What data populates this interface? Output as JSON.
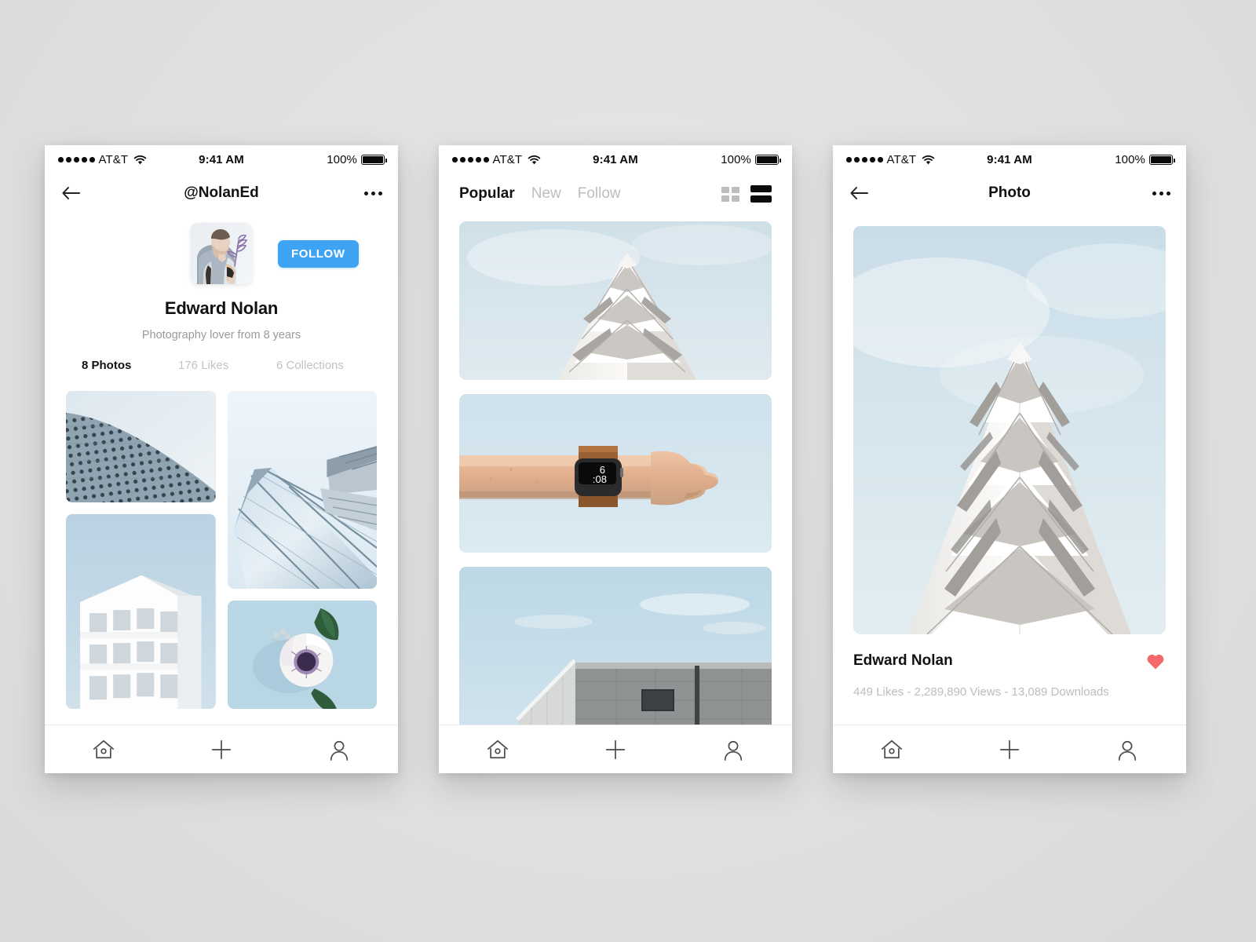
{
  "background_color": "#e0e0e0",
  "accent_color": "#3fa3f4",
  "heart_color": "#f4696a",
  "status_bar": {
    "carrier": "AT&T",
    "signal_dots": 5,
    "wifi_icon": "wifi-icon",
    "time": "9:41 AM",
    "battery_percent": "100%",
    "battery_icon": "battery-full-icon"
  },
  "screen_profile": {
    "nav": {
      "back_icon": "arrow-left-icon",
      "title": "@NolanEd",
      "more_icon": "ellipsis-icon"
    },
    "avatar_alt": "avatar",
    "follow_label": "FOLLOW",
    "name": "Edward Nolan",
    "bio": "Photography lover from 8 years",
    "stats": [
      {
        "label": "8 Photos",
        "active": true
      },
      {
        "label": "176 Likes",
        "active": false
      },
      {
        "label": "6 Collections",
        "active": false
      }
    ],
    "photos": [
      {
        "name": "perforated-facade-photo"
      },
      {
        "name": "glass-tower-photo"
      },
      {
        "name": "white-apartment-photo"
      },
      {
        "name": "anemone-flower-photo"
      }
    ]
  },
  "screen_feed": {
    "tabs": [
      {
        "label": "Popular",
        "active": true
      },
      {
        "label": "New",
        "active": false
      },
      {
        "label": "Follow",
        "active": false
      }
    ],
    "view_modes": [
      {
        "name": "grid-view-icon",
        "active": false
      },
      {
        "name": "list-view-icon",
        "active": true
      }
    ],
    "posts": [
      {
        "name": "white-stepped-building-photo"
      },
      {
        "name": "apple-watch-wrist-photo",
        "watch_time": "6:08"
      },
      {
        "name": "concrete-building-photo"
      }
    ]
  },
  "screen_detail": {
    "nav": {
      "back_icon": "arrow-left-icon",
      "title": "Photo",
      "more_icon": "ellipsis-icon"
    },
    "photo_name": "white-stepped-building-photo",
    "author": "Edward Nolan",
    "liked": true,
    "stats_line": "449 Likes - 2,289,890 Views - 13,089 Downloads"
  },
  "tab_bar": {
    "items": [
      {
        "name": "home-icon",
        "label": "Home"
      },
      {
        "name": "plus-icon",
        "label": "Add"
      },
      {
        "name": "profile-icon",
        "label": "Profile"
      }
    ]
  }
}
